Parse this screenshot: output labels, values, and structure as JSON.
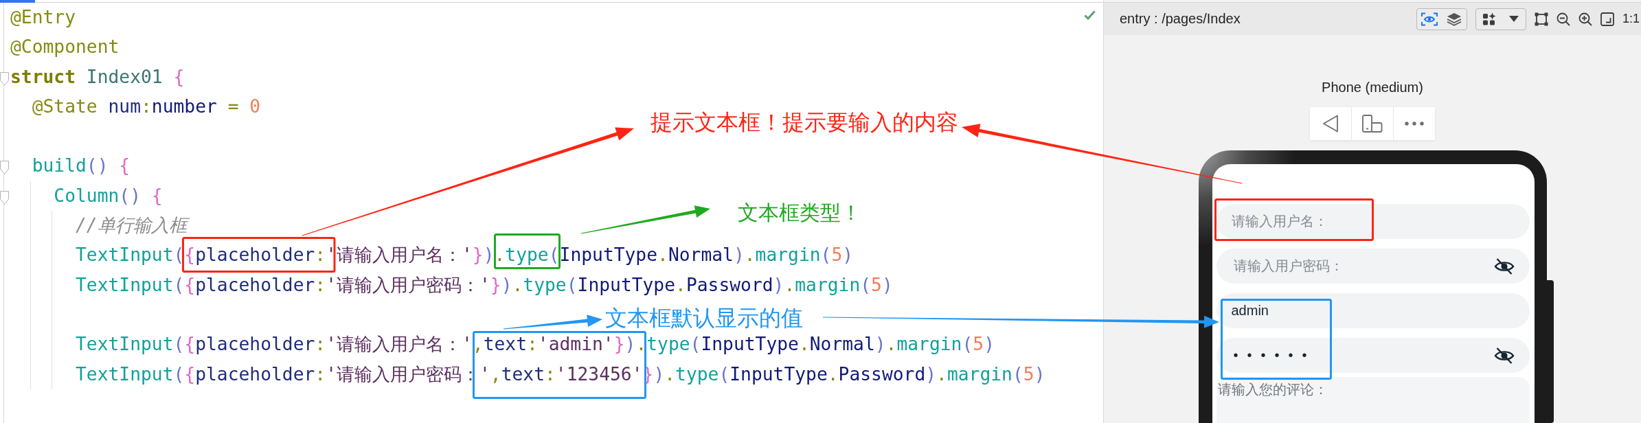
{
  "editor": {
    "lines": [
      {
        "kind": "code",
        "tokens": [
          {
            "text": "@Entry",
            "kind": "annotation"
          }
        ]
      },
      {
        "kind": "code",
        "tokens": [
          {
            "text": "@Component",
            "kind": "annotation"
          }
        ]
      },
      {
        "kind": "code",
        "tokens": [
          {
            "text": "struct",
            "kind": "keyword"
          },
          {
            "text": " Index01 ",
            "kind": "class"
          },
          {
            "text": "{",
            "kind": "brace"
          }
        ],
        "expanded": true,
        "children": [
          {
            "kind": "code",
            "tokens": [
              {
                "text": "@State",
                "kind": "annotation"
              },
              {
                "text": " num",
                "kind": "property"
              },
              {
                "text": ":",
                "kind": "operator"
              },
              {
                "text": "number",
                "kind": "type"
              },
              {
                "text": " = ",
                "kind": "operator"
              },
              {
                "text": "0",
                "kind": "number"
              }
            ]
          },
          {
            "kind": "blank"
          },
          {
            "kind": "code",
            "tokens": [
              {
                "text": "build",
                "kind": "function"
              },
              {
                "text": "() ",
                "kind": "paren"
              },
              {
                "text": "{",
                "kind": "brace"
              }
            ],
            "expanded": true,
            "children": [
              {
                "kind": "code",
                "tokens": [
                  {
                    "text": "Column",
                    "kind": "function"
                  },
                  {
                    "text": "() ",
                    "kind": "paren"
                  },
                  {
                    "text": "{",
                    "kind": "brace"
                  }
                ],
                "expanded": true,
                "children": [
                  {
                    "kind": "code",
                    "tokens": [
                      {
                        "text": "//单行输入框",
                        "kind": "comment"
                      }
                    ]
                  },
                  {
                    "kind": "code",
                    "tokens": [
                      {
                        "text": "TextInput",
                        "kind": "function"
                      },
                      {
                        "text": "(",
                        "kind": "paren"
                      },
                      {
                        "text": "{",
                        "kind": "brace"
                      },
                      {
                        "text": "placeholder",
                        "kind": "property"
                      },
                      {
                        "text": ":",
                        "kind": "operator"
                      },
                      {
                        "text": "'请输入用户名：'",
                        "kind": "string"
                      },
                      {
                        "text": "}",
                        "kind": "brace"
                      },
                      {
                        "text": ")",
                        "kind": "paren"
                      },
                      {
                        "text": ".",
                        "kind": "operator"
                      },
                      {
                        "text": "type",
                        "kind": "function"
                      },
                      {
                        "text": "(",
                        "kind": "paren"
                      },
                      {
                        "text": "InputType",
                        "kind": "type"
                      },
                      {
                        "text": ".",
                        "kind": "operator"
                      },
                      {
                        "text": "Normal",
                        "kind": "type"
                      },
                      {
                        "text": ")",
                        "kind": "paren"
                      },
                      {
                        "text": ".",
                        "kind": "operator"
                      },
                      {
                        "text": "margin",
                        "kind": "function"
                      },
                      {
                        "text": "(",
                        "kind": "paren"
                      },
                      {
                        "text": "5",
                        "kind": "number"
                      },
                      {
                        "text": ")",
                        "kind": "paren"
                      }
                    ]
                  },
                  {
                    "kind": "code",
                    "tokens": [
                      {
                        "text": "TextInput",
                        "kind": "function"
                      },
                      {
                        "text": "(",
                        "kind": "paren"
                      },
                      {
                        "text": "{",
                        "kind": "brace"
                      },
                      {
                        "text": "placeholder",
                        "kind": "property"
                      },
                      {
                        "text": ":",
                        "kind": "operator"
                      },
                      {
                        "text": "'请输入用户密码：'",
                        "kind": "string"
                      },
                      {
                        "text": "}",
                        "kind": "brace"
                      },
                      {
                        "text": ")",
                        "kind": "paren"
                      },
                      {
                        "text": ".",
                        "kind": "operator"
                      },
                      {
                        "text": "type",
                        "kind": "function"
                      },
                      {
                        "text": "(",
                        "kind": "paren"
                      },
                      {
                        "text": "InputType",
                        "kind": "type"
                      },
                      {
                        "text": ".",
                        "kind": "operator"
                      },
                      {
                        "text": "Password",
                        "kind": "type"
                      },
                      {
                        "text": ")",
                        "kind": "paren"
                      },
                      {
                        "text": ".",
                        "kind": "operator"
                      },
                      {
                        "text": "margin",
                        "kind": "function"
                      },
                      {
                        "text": "(",
                        "kind": "paren"
                      },
                      {
                        "text": "5",
                        "kind": "number"
                      },
                      {
                        "text": ")",
                        "kind": "paren"
                      }
                    ]
                  },
                  {
                    "kind": "blank"
                  },
                  {
                    "kind": "code",
                    "tokens": [
                      {
                        "text": "TextInput",
                        "kind": "function"
                      },
                      {
                        "text": "(",
                        "kind": "paren"
                      },
                      {
                        "text": "{",
                        "kind": "brace"
                      },
                      {
                        "text": "placeholder",
                        "kind": "property"
                      },
                      {
                        "text": ":",
                        "kind": "operator"
                      },
                      {
                        "text": "'请输入用户名：'",
                        "kind": "string"
                      },
                      {
                        "text": ",",
                        "kind": "operator"
                      },
                      {
                        "text": "text",
                        "kind": "property"
                      },
                      {
                        "text": ":",
                        "kind": "operator"
                      },
                      {
                        "text": "'admin'",
                        "kind": "string"
                      },
                      {
                        "text": "}",
                        "kind": "brace"
                      },
                      {
                        "text": ")",
                        "kind": "paren"
                      },
                      {
                        "text": ".",
                        "kind": "operator"
                      },
                      {
                        "text": "type",
                        "kind": "function"
                      },
                      {
                        "text": "(",
                        "kind": "paren"
                      },
                      {
                        "text": "InputType",
                        "kind": "type"
                      },
                      {
                        "text": ".",
                        "kind": "operator"
                      },
                      {
                        "text": "Normal",
                        "kind": "type"
                      },
                      {
                        "text": ")",
                        "kind": "paren"
                      },
                      {
                        "text": ".",
                        "kind": "operator"
                      },
                      {
                        "text": "margin",
                        "kind": "function"
                      },
                      {
                        "text": "(",
                        "kind": "paren"
                      },
                      {
                        "text": "5",
                        "kind": "number"
                      },
                      {
                        "text": ")",
                        "kind": "paren"
                      }
                    ]
                  },
                  {
                    "kind": "code",
                    "tokens": [
                      {
                        "text": "TextInput",
                        "kind": "function"
                      },
                      {
                        "text": "(",
                        "kind": "paren"
                      },
                      {
                        "text": "{",
                        "kind": "brace"
                      },
                      {
                        "text": "placeholder",
                        "kind": "property"
                      },
                      {
                        "text": ":",
                        "kind": "operator"
                      },
                      {
                        "text": "'请输入用户密码：'",
                        "kind": "string"
                      },
                      {
                        "text": ",",
                        "kind": "operator"
                      },
                      {
                        "text": "text",
                        "kind": "property"
                      },
                      {
                        "text": ":",
                        "kind": "operator"
                      },
                      {
                        "text": "'123456'",
                        "kind": "string"
                      },
                      {
                        "text": "}",
                        "kind": "brace"
                      },
                      {
                        "text": ")",
                        "kind": "paren"
                      },
                      {
                        "text": ".",
                        "kind": "operator"
                      },
                      {
                        "text": "type",
                        "kind": "function"
                      },
                      {
                        "text": "(",
                        "kind": "paren"
                      },
                      {
                        "text": "InputType",
                        "kind": "type"
                      },
                      {
                        "text": ".",
                        "kind": "operator"
                      },
                      {
                        "text": "Password",
                        "kind": "type"
                      },
                      {
                        "text": ")",
                        "kind": "paren"
                      },
                      {
                        "text": ".",
                        "kind": "operator"
                      },
                      {
                        "text": "margin",
                        "kind": "function"
                      },
                      {
                        "text": "(",
                        "kind": "paren"
                      },
                      {
                        "text": "5",
                        "kind": "number"
                      },
                      {
                        "text": ")",
                        "kind": "paren"
                      }
                    ]
                  }
                ]
              }
            ]
          }
        ]
      }
    ]
  },
  "preview": {
    "toolbar": {
      "path": "entry : /pages/Index",
      "view_toggles": [
        {
          "kind": "inspect",
          "selected": true
        },
        {
          "kind": "layers",
          "selected": false
        }
      ],
      "actual_size_label": "1:1"
    },
    "device_label": "Phone (medium)",
    "fields": [
      {
        "kind": "text",
        "placeholder": "请输入用户名："
      },
      {
        "kind": "password",
        "placeholder": "请输入用户密码："
      },
      {
        "kind": "text",
        "value": "admin"
      },
      {
        "kind": "password",
        "value": "••••••"
      },
      {
        "kind": "textarea",
        "placeholder": "请输入您的评论："
      }
    ]
  },
  "annotations": [
    {
      "text": "提示文本框！提示要输入的内容",
      "color": "#ff2414"
    },
    {
      "text": "文本框类型！",
      "color": "#1eaa1e"
    },
    {
      "text": "文本框默认显示的值",
      "color": "#2196f3"
    }
  ]
}
